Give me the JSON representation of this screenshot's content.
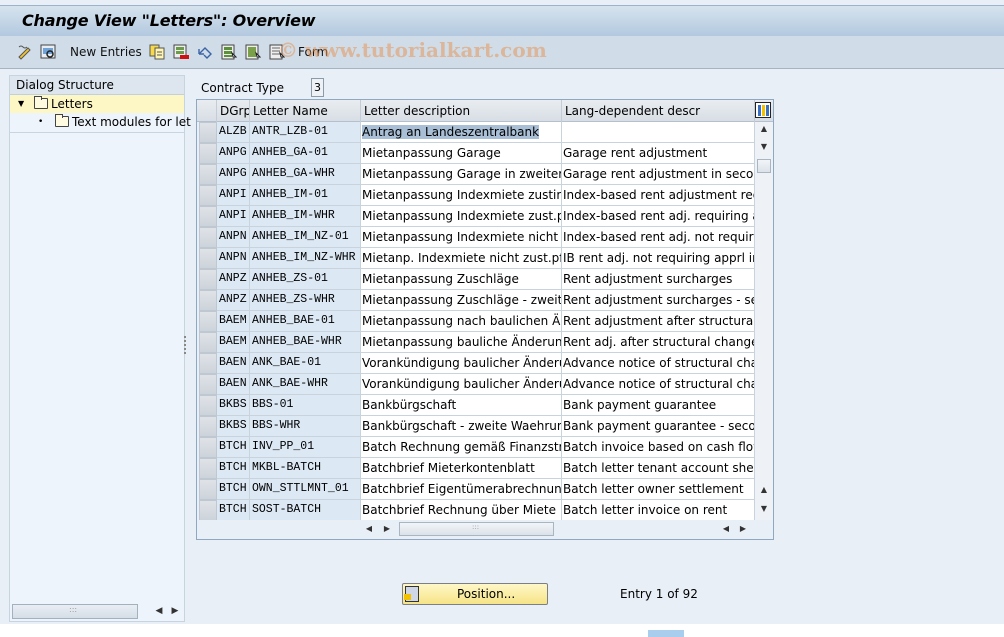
{
  "window": {
    "title": "Change View \"Letters\": Overview",
    "watermark": "© www.tutorialkart.com"
  },
  "toolbar": {
    "items": [
      {
        "icon": "display-change-icon",
        "label": ""
      },
      {
        "icon": "find-icon",
        "label": ""
      },
      {
        "icon": "",
        "label": "New Entries"
      },
      {
        "icon": "copy-as-icon",
        "label": ""
      },
      {
        "icon": "delete-icon",
        "label": ""
      },
      {
        "icon": "undo-change-icon",
        "label": ""
      },
      {
        "icon": "select-all-icon",
        "label": ""
      },
      {
        "icon": "select-block-icon",
        "label": ""
      },
      {
        "icon": "deselect-all-icon",
        "label": ""
      },
      {
        "icon": "",
        "label": "Form"
      }
    ]
  },
  "dialog_structure": {
    "header": "Dialog Structure",
    "nodes": [
      {
        "label": "Letters",
        "expanded": true,
        "selected": true
      },
      {
        "label": "Text modules for let",
        "expanded": false,
        "selected": false
      }
    ]
  },
  "contract_type": {
    "label": "Contract Type",
    "value": "3"
  },
  "table": {
    "columns": [
      "DGrp",
      "Letter Name",
      "Letter description",
      "Lang-dependent descr"
    ],
    "rows": [
      {
        "dgrp": "ALZB",
        "name": "ANTR_LZB-01",
        "desc": "Antrag an Landeszentralbank",
        "lang": ""
      },
      {
        "dgrp": "ANPG",
        "name": "ANHEB_GA-01",
        "desc": "Mietanpassung Garage",
        "lang": "Garage rent adjustment"
      },
      {
        "dgrp": "ANPG",
        "name": "ANHEB_GA-WHR",
        "desc": "Mietanpassung Garage in zweiter …",
        "lang": "Garage rent adjustment in second"
      },
      {
        "dgrp": "ANPI",
        "name": "ANHEB_IM-01",
        "desc": "Mietanpassung Indexmiete zustimm…",
        "lang": "Index-based rent adjustment requi"
      },
      {
        "dgrp": "ANPI",
        "name": "ANHEB_IM-WHR",
        "desc": "Mietanpassung Indexmiete zust.pfl.…",
        "lang": "Index-based rent adj. requiring app"
      },
      {
        "dgrp": "ANPN",
        "name": "ANHEB_IM_NZ-01",
        "desc": "Mietanpassung Indexmiete nicht zu…",
        "lang": "Index-based rent adj. not requiring"
      },
      {
        "dgrp": "ANPN",
        "name": "ANHEB_IM_NZ-WHR",
        "desc": "Mietanp. Indexmiete nicht zust.pfl.…",
        "lang": "IB rent adj. not requiring apprl in 2"
      },
      {
        "dgrp": "ANPZ",
        "name": "ANHEB_ZS-01",
        "desc": "Mietanpassung Zuschläge",
        "lang": "Rent adjustment surcharges"
      },
      {
        "dgrp": "ANPZ",
        "name": "ANHEB_ZS-WHR",
        "desc": "Mietanpassung Zuschläge - zweite …",
        "lang": "Rent adjustment surcharges - seco"
      },
      {
        "dgrp": "BAEM",
        "name": "ANHEB_BAE-01",
        "desc": "Mietanpassung nach baulichen Änd…",
        "lang": "Rent adjustment after structural ch"
      },
      {
        "dgrp": "BAEM",
        "name": "ANHEB_BAE-WHR",
        "desc": "Mietanpassung bauliche Änderunge…",
        "lang": "Rent adj. after structural changes -"
      },
      {
        "dgrp": "BAEN",
        "name": "ANK_BAE-01",
        "desc": "Vorankündigung baulicher Änderun…",
        "lang": "Advance notice of structural chang"
      },
      {
        "dgrp": "BAEN",
        "name": "ANK_BAE-WHR",
        "desc": "Vorankündigung baulicher Änderun…",
        "lang": "Advance notice of structural chang"
      },
      {
        "dgrp": "BKBS",
        "name": "BBS-01",
        "desc": "Bankbürgschaft",
        "lang": "Bank payment guarantee"
      },
      {
        "dgrp": "BKBS",
        "name": "BBS-WHR",
        "desc": "Bankbürgschaft - zweite Waehrung",
        "lang": "Bank payment guarantee - second"
      },
      {
        "dgrp": "BTCH",
        "name": "INV_PP_01",
        "desc": "Batch Rechnung gemäß Finanzstro…",
        "lang": "Batch invoice based on cash flow …"
      },
      {
        "dgrp": "BTCH",
        "name": "MKBL-BATCH",
        "desc": "Batchbrief Mieterkontenblatt",
        "lang": "Batch letter tenant account sheet"
      },
      {
        "dgrp": "BTCH",
        "name": "OWN_STTLMNT_01",
        "desc": "Batchbrief Eigentümerabrechnung",
        "lang": "Batch letter owner settlement"
      },
      {
        "dgrp": "BTCH",
        "name": "SOST-BATCH",
        "desc": "Batchbrief Rechnung über Miete",
        "lang": "Batch letter invoice on rent"
      }
    ],
    "highlighted_cell": {
      "row": 0,
      "column": "desc"
    }
  },
  "footer": {
    "position_button": "Position...",
    "entry_info": "Entry 1 of 92"
  },
  "colors": {
    "title_bar": "#b3c9df",
    "toolbar": "#d0dde8",
    "selection_yellow": "#fdf7c6",
    "key_column": "#dce8f4",
    "highlight": "#a9bfd6",
    "position_button": "#f6e486"
  }
}
